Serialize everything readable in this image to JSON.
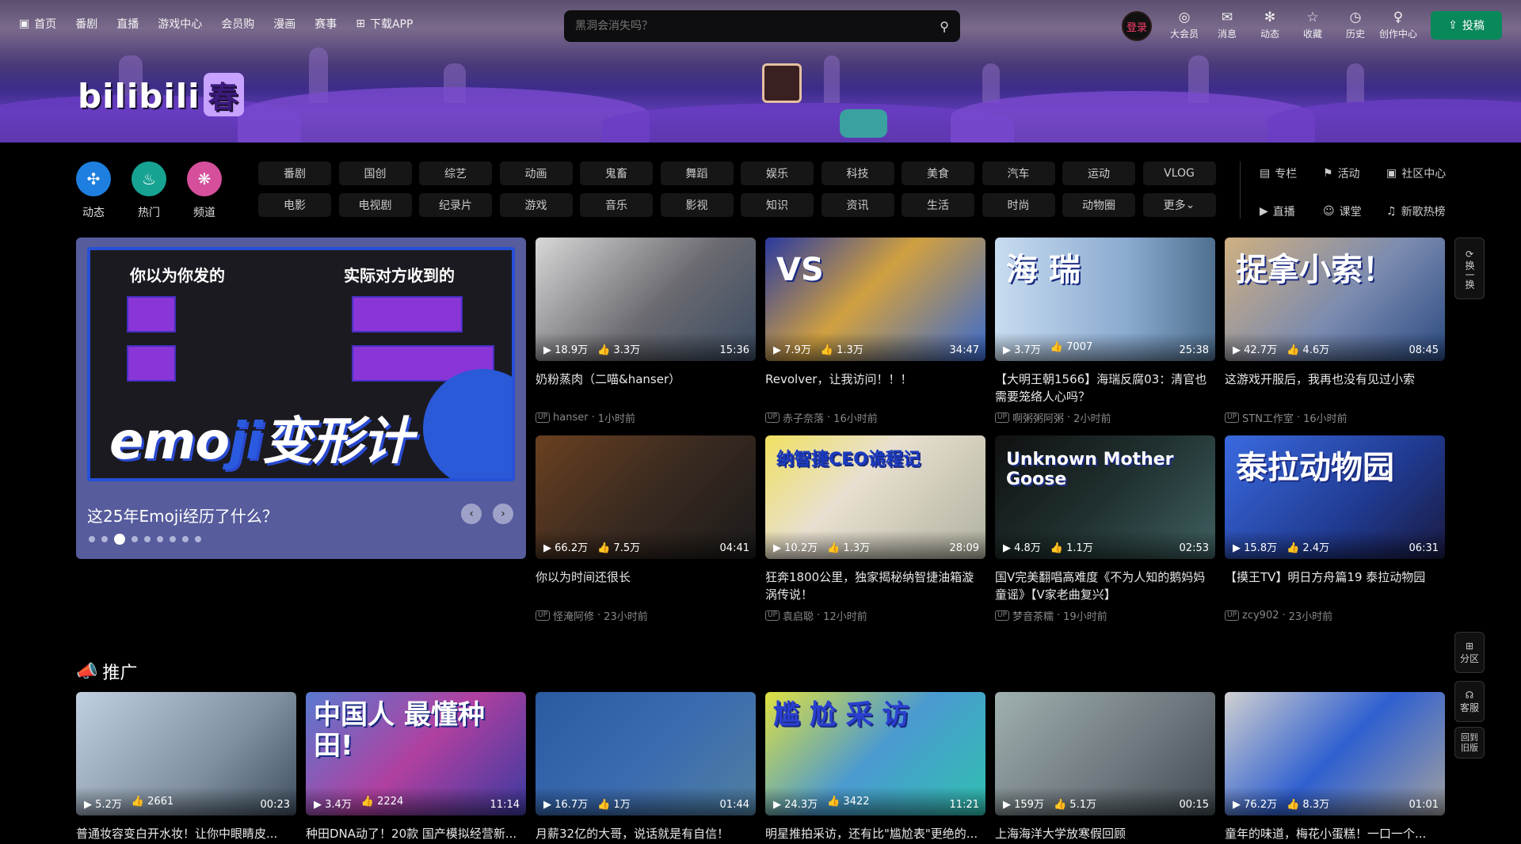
{
  "topnav": {
    "items": [
      "首页",
      "番剧",
      "直播",
      "游戏中心",
      "会员购",
      "漫画",
      "赛事",
      "下载APP"
    ]
  },
  "search": {
    "placeholder": "黑洞会消失吗？"
  },
  "user_nav": {
    "login": "登录",
    "items": [
      {
        "label": "大会员",
        "icon": "vip-icon"
      },
      {
        "label": "消息",
        "icon": "message-icon"
      },
      {
        "label": "动态",
        "icon": "dynamic-icon"
      },
      {
        "label": "收藏",
        "icon": "star-icon"
      },
      {
        "label": "历史",
        "icon": "history-icon"
      },
      {
        "label": "创作中心",
        "icon": "bulb-icon"
      }
    ],
    "upload": "投稿"
  },
  "logo": {
    "text": "bilibili",
    "badge": "春"
  },
  "channels": [
    {
      "label": "动态",
      "color": "#1e7fe0"
    },
    {
      "label": "热门",
      "color": "#17a392"
    },
    {
      "label": "频道",
      "color": "#d54f9b"
    }
  ],
  "categories": [
    "番剧",
    "国创",
    "综艺",
    "动画",
    "鬼畜",
    "舞蹈",
    "娱乐",
    "科技",
    "美食",
    "汽车",
    "运动",
    "VLOG",
    "电影",
    "电视剧",
    "纪录片",
    "游戏",
    "音乐",
    "影视",
    "知识",
    "资讯",
    "生活",
    "时尚",
    "动物圈",
    "更多"
  ],
  "extras": [
    "专栏",
    "活动",
    "社区中心",
    "直播",
    "课堂",
    "新歌热榜"
  ],
  "banner": {
    "left_label": "你以为你发的",
    "right_label": "实际对方收到的",
    "big_title_a": "emo",
    "big_title_b": "ji",
    "big_title_c": "变形计",
    "caption": "这25年Emoji经历了什么？",
    "dots": 9,
    "active_dot": 2
  },
  "feed": [
    {
      "title": "奶粉蒸肉（二喵&hanser）",
      "views": "18.9万",
      "likes": "3.3万",
      "duration": "15:36",
      "author": "hanser",
      "time": "1小时前",
      "bg": "linear-gradient(135deg,#d8d8d8,#6a6a70 55%,#3a4a60)"
    },
    {
      "title": "Revolver，让我访问！！！",
      "views": "7.9万",
      "likes": "1.3万",
      "duration": "34:47",
      "author": "赤子奈落",
      "time": "16小时前",
      "bg": "linear-gradient(135deg,#2a3aa0,#d0a040 45%,#3a6ad0)",
      "big": "VS"
    },
    {
      "title": "【大明王朝1566】海瑞反腐03：清官也需要笼络人心吗？",
      "views": "3.7万",
      "likes": "7007",
      "duration": "25:38",
      "author": "啊粥粥阿粥",
      "time": "2小时前",
      "bg": "linear-gradient(90deg,#c8dcf0,#8aaad0 60%,#507090)",
      "big": "海 瑞"
    },
    {
      "title": "这游戏开服后，我再也没有见过小索",
      "views": "42.7万",
      "likes": "4.6万",
      "duration": "08:45",
      "author": "STN工作室",
      "time": "16小时前",
      "bg": "linear-gradient(135deg,#d0b080,#7a8ab0 55%,#2a4a80)",
      "big": "捉拿小索！"
    },
    {
      "title": "你以为时间还很长",
      "views": "66.2万",
      "likes": "7.5万",
      "duration": "04:41",
      "author": "怪淹阿修",
      "time": "23小时前",
      "bg": "linear-gradient(135deg,#6a4020,#3a2a20 50%,#1a1a1a)"
    },
    {
      "title": "狂奔1800公里，独家揭秘纳智捷油箱漩涡传说！",
      "views": "10.2万",
      "likes": "1.3万",
      "duration": "28:09",
      "author": "袁启聪",
      "time": "12小时前",
      "bg": "linear-gradient(135deg,#f0e060,#e8e0d0 40%,#b0b0a0)",
      "big": "纳智捷CEO诡程记"
    },
    {
      "title": "国V完美翻唱高难度《不为人知的鹅妈妈童谣》【V家老曲复兴】",
      "views": "4.8万",
      "likes": "1.1万",
      "duration": "02:53",
      "author": "梦音茶糯",
      "time": "19小时前",
      "bg": "linear-gradient(135deg,#101010,#203030 50%,#406060)",
      "big": "Unknown Mother Goose"
    },
    {
      "title": "【摸王TV】明日方舟篇19 泰拉动物园",
      "views": "15.8万",
      "likes": "2.4万",
      "duration": "06:31",
      "author": "zcy902",
      "time": "23小时前",
      "bg": "linear-gradient(135deg,#3a6ae0,#203a90 60%,#1a1a40)",
      "big": "泰拉动物园"
    }
  ],
  "promo": {
    "title": "推广",
    "items": [
      {
        "title": "普通妆容变白开水妆！让你中眼睛皮...",
        "views": "5.2万",
        "likes": "2661",
        "duration": "00:23",
        "bg": "linear-gradient(135deg,#c0d0e0,#8090a0 60%,#405060)"
      },
      {
        "title": "种田DNA动了！20款 国产模拟经营新...",
        "views": "3.4万",
        "likes": "2224",
        "duration": "11:14",
        "bg": "linear-gradient(135deg,#5a7ad0,#b040a0 50%,#3a3aa0)",
        "big": "中国人 最懂种田!"
      },
      {
        "title": "月薪32亿的大哥，说话就是有自信！",
        "views": "16.7万",
        "likes": "1万",
        "duration": "01:44",
        "bg": "linear-gradient(135deg,#2a5aa0,#3a6ab0 50%,#5080a0)"
      },
      {
        "title": "明星推拍采访，还有比\"尴尬表\"更绝的...",
        "views": "24.3万",
        "likes": "3422",
        "duration": "11:21",
        "bg": "linear-gradient(135deg,#e0e040,#4a9ad0 50%,#30c0b0)",
        "big": "尴 尬 采 访"
      },
      {
        "title": "上海海洋大学放寒假回顾",
        "views": "159万",
        "likes": "5.1万",
        "duration": "00:15",
        "bg": "linear-gradient(135deg,#a0b0b0,#707a80 55%,#404a50)"
      },
      {
        "title": "童年的味道，梅花小蛋糕！一口一个...",
        "views": "76.2万",
        "likes": "8.3万",
        "duration": "01:01",
        "bg": "linear-gradient(135deg,#d0d0d0,#3060d0 50%,#a0a0a0)"
      }
    ]
  },
  "side_tools": {
    "refresh": "换一换",
    "zone": "分区",
    "service": "客服",
    "old": "回到旧版"
  }
}
